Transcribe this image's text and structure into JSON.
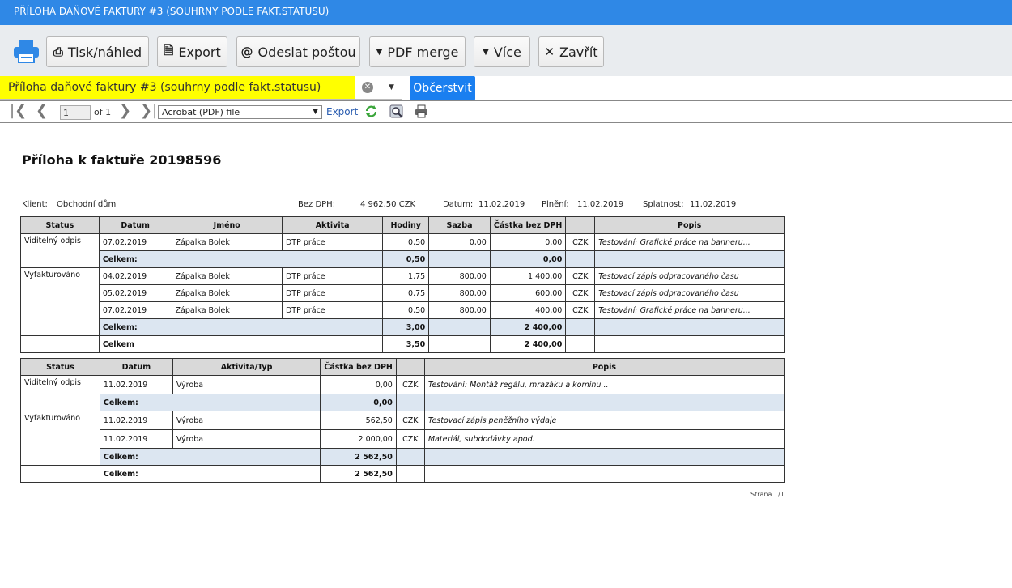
{
  "window": {
    "title": "PŘÍLOHA DAŇOVÉ FAKTURY #3 (SOUHRNY PODLE FAKT.STATUSU)"
  },
  "toolbar": {
    "print_label": "Tisk/náhled",
    "export_label": "Export",
    "email_label": "Odeslat poštou",
    "pdfmerge_label": "PDF merge",
    "more_label": "Více",
    "close_label": "Zavřít"
  },
  "search": {
    "value": "Příloha daňové faktury #3 (souhrny podle fakt.statusu)",
    "refresh_label": "Občerstvit"
  },
  "viewer": {
    "page": "1",
    "of_label": "of 1",
    "format": "Acrobat (PDF) file",
    "export_label": "Export"
  },
  "document": {
    "title": "Příloha k faktuře 20198596",
    "info": {
      "client_label": "Klient:",
      "client": "Obchodní dům",
      "nodph_label": "Bez DPH:",
      "nodph": "4 962,50 CZK",
      "date_label": "Datum:",
      "date": "11.02.2019",
      "fulfil_label": "Plnění:",
      "fulfil": "11.02.2019",
      "due_label": "Splatnost:",
      "due": "11.02.2019"
    },
    "table1": {
      "headers": [
        "Status",
        "Datum",
        "Jméno",
        "Aktivita",
        "Hodiny",
        "Sazba",
        "Částka bez DPH",
        "",
        "Popis"
      ],
      "g1": {
        "status": "Viditelný odpis",
        "rows": [
          [
            "07.02.2019",
            "Zápalka Bolek",
            "DTP práce",
            "0,50",
            "0,00",
            "0,00",
            "CZK",
            "Testování: Grafické práce na banneru..."
          ]
        ],
        "sub_label": "Celkem:",
        "sub_hours": "0,50",
        "sub_amount": "0,00"
      },
      "g2": {
        "status": "Vyfakturováno",
        "rows": [
          [
            "04.02.2019",
            "Zápalka Bolek",
            "DTP práce",
            "1,75",
            "800,00",
            "1 400,00",
            "CZK",
            "Testovací zápis odpracovaného času"
          ],
          [
            "05.02.2019",
            "Zápalka Bolek",
            "DTP práce",
            "0,75",
            "800,00",
            "600,00",
            "CZK",
            "Testovací zápis odpracovaného času"
          ],
          [
            "07.02.2019",
            "Zápalka Bolek",
            "DTP práce",
            "0,50",
            "800,00",
            "400,00",
            "CZK",
            "Testování: Grafické práce na banneru..."
          ]
        ],
        "sub_label": "Celkem:",
        "sub_hours": "3,00",
        "sub_amount": "2 400,00"
      },
      "total_label": "Celkem",
      "total_hours": "3,50",
      "total_amount": "2 400,00"
    },
    "table2": {
      "headers": [
        "Status",
        "Datum",
        "Aktivita/Typ",
        "Částka bez DPH",
        "",
        "Popis"
      ],
      "g1": {
        "status": "Viditelný odpis",
        "rows": [
          [
            "11.02.2019",
            "Výroba",
            "0,00",
            "CZK",
            "Testování: Montáž regálu, mrazáku a komínu..."
          ]
        ],
        "sub_label": "Celkem:",
        "sub_amount": "0,00"
      },
      "g2": {
        "status": "Vyfakturováno",
        "rows": [
          [
            "11.02.2019",
            "Výroba",
            "562,50",
            "CZK",
            "Testovací zápis peněžního výdaje"
          ],
          [
            "11.02.2019",
            "Výroba",
            "2 000,00",
            "CZK",
            "Materiál, subdodávky apod."
          ]
        ],
        "sub_label": "Celkem:",
        "sub_amount": "2 562,50"
      },
      "total_label": "Celkem:",
      "total_amount": "2 562,50"
    },
    "footer": "Strana 1/1"
  }
}
